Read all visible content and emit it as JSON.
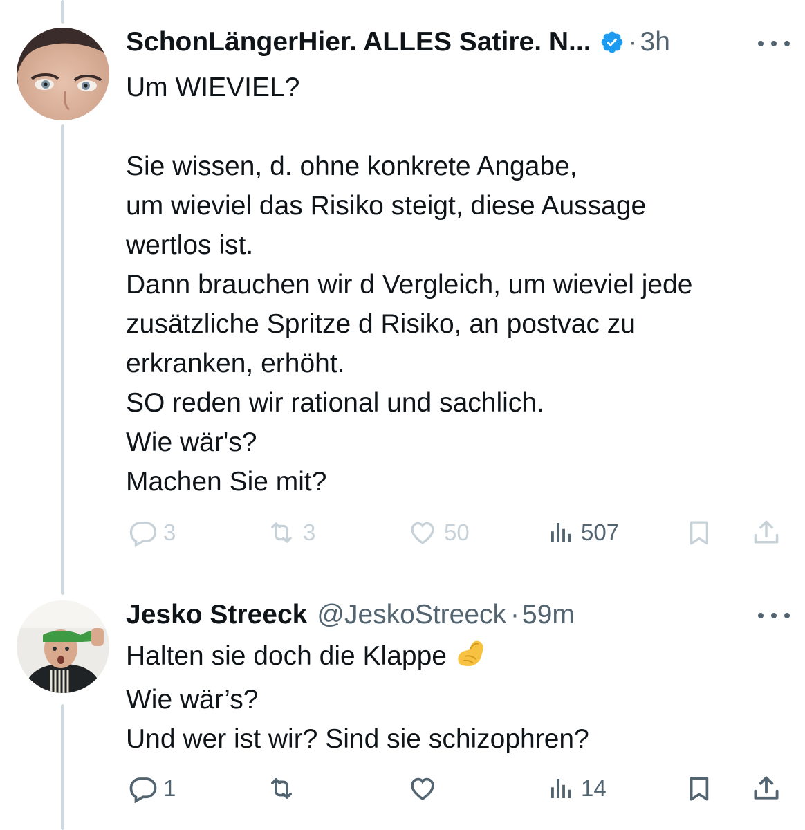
{
  "tweet1": {
    "author_name": "SchonLängerHier. ALLES Satire. N...",
    "separator": "·",
    "time": "3h",
    "lines": [
      "Um WIEVIEL?",
      "",
      "Sie wissen, d. ohne konkrete Angabe,",
      "um wieviel das Risiko steigt, diese Aussage",
      "wertlos ist.",
      "Dann brauchen wir d Vergleich, um wieviel jede",
      "zusätzliche Spritze d Risiko, an postvac zu",
      "erkranken, erhöht.",
      "SO reden wir rational und sachlich.",
      "Wie wär's?",
      "Machen Sie mit?"
    ],
    "replies": "3",
    "reposts": "3",
    "likes": "50",
    "views": "507"
  },
  "tweet2": {
    "author_name": "Jesko Streeck",
    "handle": "@JeskoStreeck",
    "separator": "·",
    "time": "59m",
    "lines": [
      "Halten sie doch die Klappe",
      "Wie wär’s?",
      "Und wer ist wir? Sind sie schizophren?"
    ],
    "replies": "1",
    "views": "14"
  },
  "icons": {
    "verified": "verified-badge-icon",
    "reply": "reply-bubble-icon",
    "repost": "repost-arrows-icon",
    "like": "heart-icon",
    "views": "bar-chart-icon",
    "bookmark": "bookmark-icon",
    "share": "share-icon",
    "more": "more-dots-icon",
    "emoji": "pinched-fingers-emoji"
  },
  "colors": {
    "text": "#0f1419",
    "secondary": "#536471",
    "faded": "#c7d1d8",
    "verified": "#1d9bf0",
    "thread_line": "#cfd9de"
  }
}
